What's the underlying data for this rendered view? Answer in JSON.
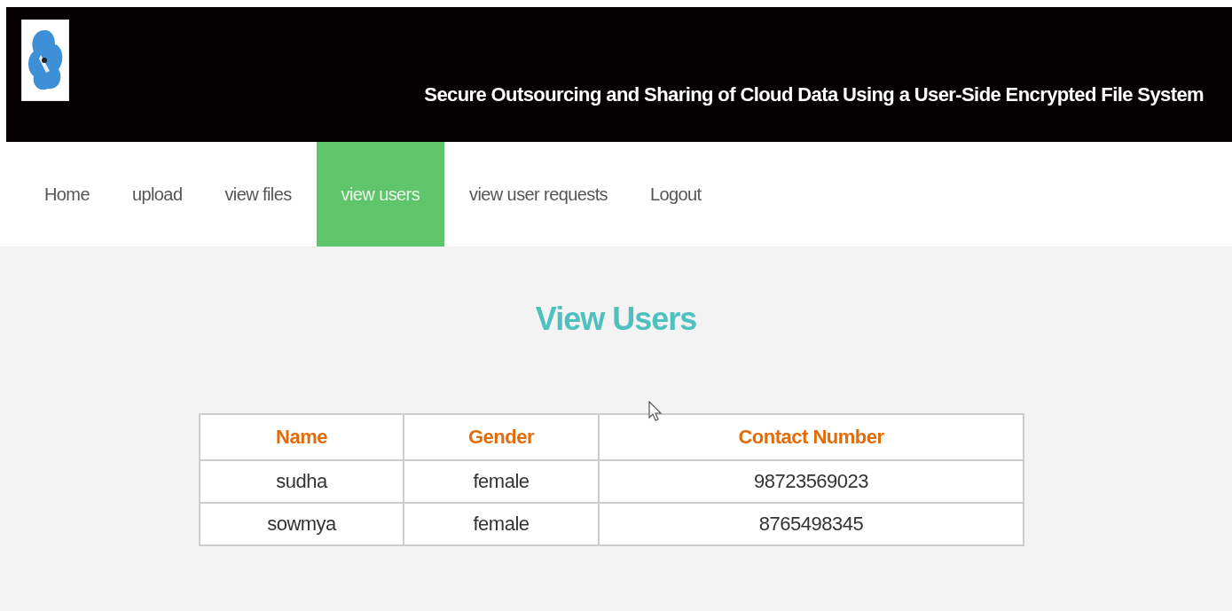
{
  "header": {
    "title": "Secure Outsourcing and Sharing of Cloud Data Using a User-Side Encrypted File System"
  },
  "nav": [
    {
      "label": "Home",
      "selected": false
    },
    {
      "label": "upload",
      "selected": false
    },
    {
      "label": "view files",
      "selected": false
    },
    {
      "label": "view users",
      "selected": true
    },
    {
      "label": "view user requests",
      "selected": false
    },
    {
      "label": "Logout",
      "selected": false
    }
  ],
  "heading": "View Users",
  "table": {
    "columns": [
      "Name",
      "Gender",
      "Contact Number"
    ],
    "rows": [
      [
        "sudha",
        "female",
        "98723569023"
      ],
      [
        "sowmya",
        "female",
        "8765498345"
      ]
    ]
  }
}
